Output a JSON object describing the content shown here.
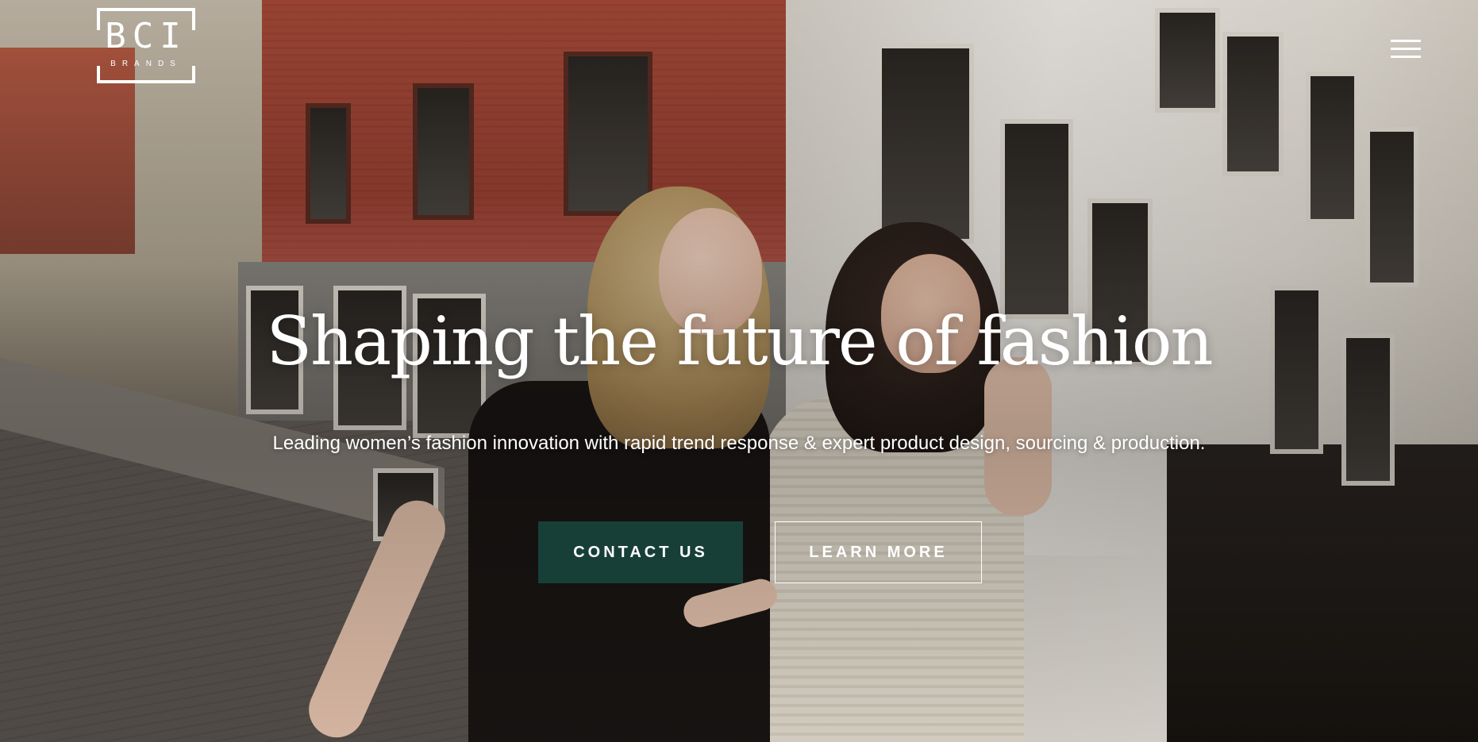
{
  "brand": {
    "logo_text": "BCI",
    "logo_subtext": "BRANDS"
  },
  "hero": {
    "headline": "Shaping the future of fashion",
    "subheadline": "Leading women’s fashion innovation with rapid trend response & expert product design, sourcing & production.",
    "primary_button": "CONTACT US",
    "secondary_button": "LEARN MORE"
  },
  "colors": {
    "primary_button_bg": "#173f37",
    "text": "#ffffff"
  },
  "icons": {
    "menu": "hamburger-menu-icon"
  }
}
